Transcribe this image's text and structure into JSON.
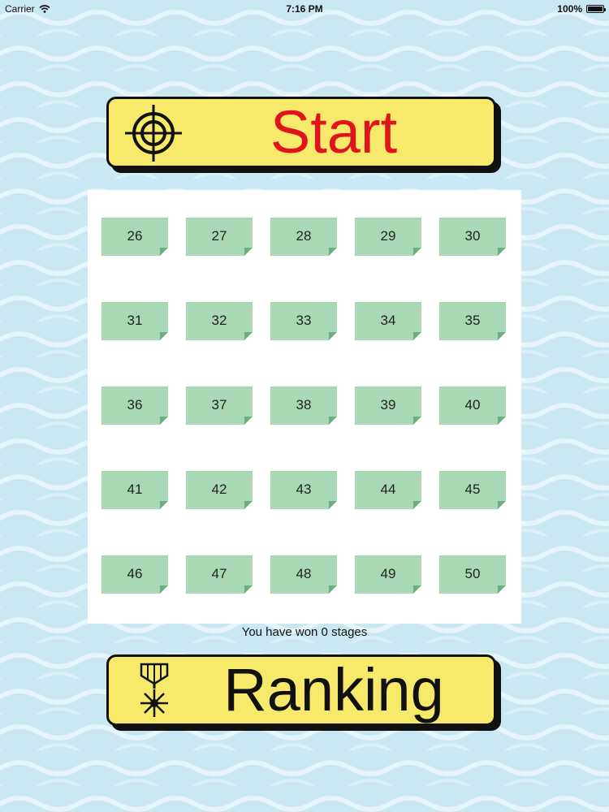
{
  "status_bar": {
    "carrier": "Carrier",
    "time": "7:16 PM",
    "battery": "100%"
  },
  "start_button": {
    "label": "Start",
    "icon": "crosshair-icon"
  },
  "ranking_button": {
    "label": "Ranking",
    "icon": "medal-icon"
  },
  "stages": [
    "26",
    "27",
    "28",
    "29",
    "30",
    "31",
    "32",
    "33",
    "34",
    "35",
    "36",
    "37",
    "38",
    "39",
    "40",
    "41",
    "42",
    "43",
    "44",
    "45",
    "46",
    "47",
    "48",
    "49",
    "50"
  ],
  "won_text": "You have won 0 stages",
  "colors": {
    "background": "#c9e8f1",
    "button": "#f7ea6a",
    "start_text": "#e0141c",
    "tile": "#a8d8b4"
  }
}
